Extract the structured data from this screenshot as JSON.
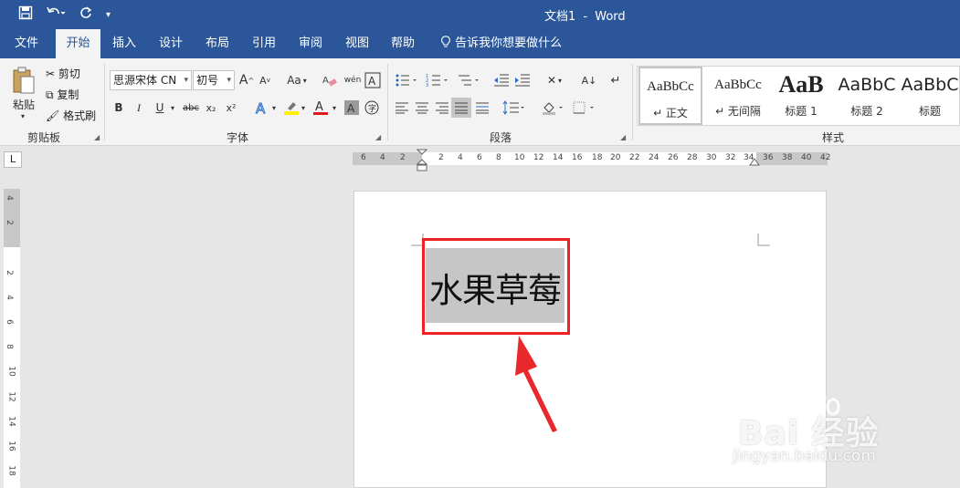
{
  "app": {
    "document_name": "文档1",
    "separator": "-",
    "app_name": "Word"
  },
  "qat": {
    "save_icon": "save-icon",
    "undo_icon": "undo-icon",
    "redo_icon": "redo-icon",
    "customize_icon": "customize-icon"
  },
  "tabs": [
    {
      "label": "文件"
    },
    {
      "label": "开始"
    },
    {
      "label": "插入"
    },
    {
      "label": "设计"
    },
    {
      "label": "布局"
    },
    {
      "label": "引用"
    },
    {
      "label": "审阅"
    },
    {
      "label": "视图"
    },
    {
      "label": "帮助"
    }
  ],
  "tell_me": {
    "label": "告诉我你想要做什么",
    "icon": "lightbulb-icon"
  },
  "clipboard": {
    "paste": "粘贴",
    "cut": "剪切",
    "copy": "复制",
    "format_painter": "格式刷",
    "group_label": "剪贴板"
  },
  "font": {
    "font_name": "思源宋体 CN",
    "font_size": "初号",
    "grow": "A",
    "shrink": "A",
    "change_case": "Aa",
    "bold": "B",
    "italic": "I",
    "underline": "U",
    "strikethrough": "abc",
    "subscript": "x₂",
    "superscript": "x²",
    "group_label": "字体"
  },
  "paragraph": {
    "group_label": "段落"
  },
  "styles": {
    "group_label": "样式",
    "items": [
      {
        "sample": "AaBbCc",
        "name": "↵ 正文"
      },
      {
        "sample": "AaBbCc",
        "name": "↵ 无间隔"
      },
      {
        "sample": "AaB",
        "name": "标题 1"
      },
      {
        "sample": "AaBbC",
        "name": "标题 2"
      },
      {
        "sample": "AaBbC",
        "name": "标题"
      }
    ]
  },
  "ruler": {
    "corner": "L",
    "h_numbers": [
      "6",
      "4",
      "2",
      "2",
      "4",
      "6",
      "8",
      "10",
      "12",
      "14",
      "16",
      "18",
      "20",
      "22",
      "24",
      "26",
      "28",
      "30",
      "32",
      "34",
      "36",
      "38",
      "40",
      "42"
    ],
    "v_numbers": [
      "4",
      "2",
      "2",
      "4",
      "6",
      "8",
      "10",
      "12",
      "14",
      "16",
      "18"
    ]
  },
  "document": {
    "text": "水果草莓"
  },
  "watermark": {
    "text": "Bai 经验",
    "url": "jingyan.baidu.com"
  },
  "colors": {
    "title_bar": "#2b579a",
    "ribbon": "#f3f3f3",
    "highlight_border": "#e22222",
    "selection": "#c6c6c6"
  }
}
